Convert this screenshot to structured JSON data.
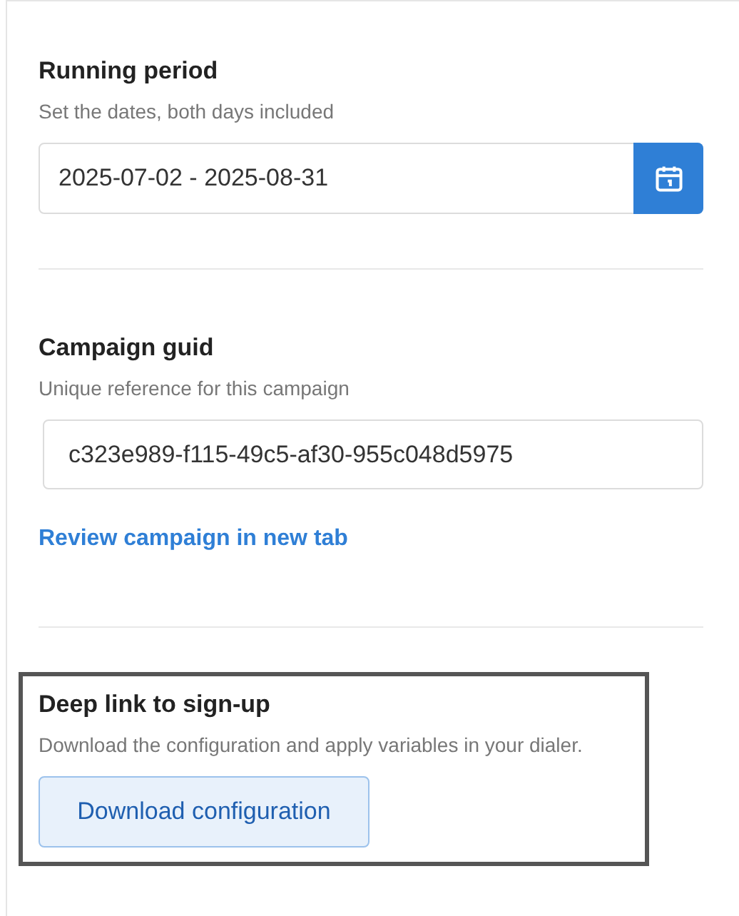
{
  "sections": [
    {
      "kind": "date_range",
      "title": "Running period",
      "subtitle": "Set the dates, both days included",
      "value": "2025-07-02 - 2025-08-31",
      "highlighted": false
    },
    {
      "kind": "text",
      "title": "Campaign guid",
      "subtitle": "Unique reference for this campaign",
      "value": "c323e989-f115-49c5-af30-955c048d5975",
      "link": "Review campaign in new tab",
      "highlighted": false
    },
    {
      "kind": "action",
      "title": "Deep link to sign-up",
      "subtitle": "Download the configuration and apply variables in your dialer.",
      "button": "Download configuration",
      "highlighted": true
    }
  ]
}
